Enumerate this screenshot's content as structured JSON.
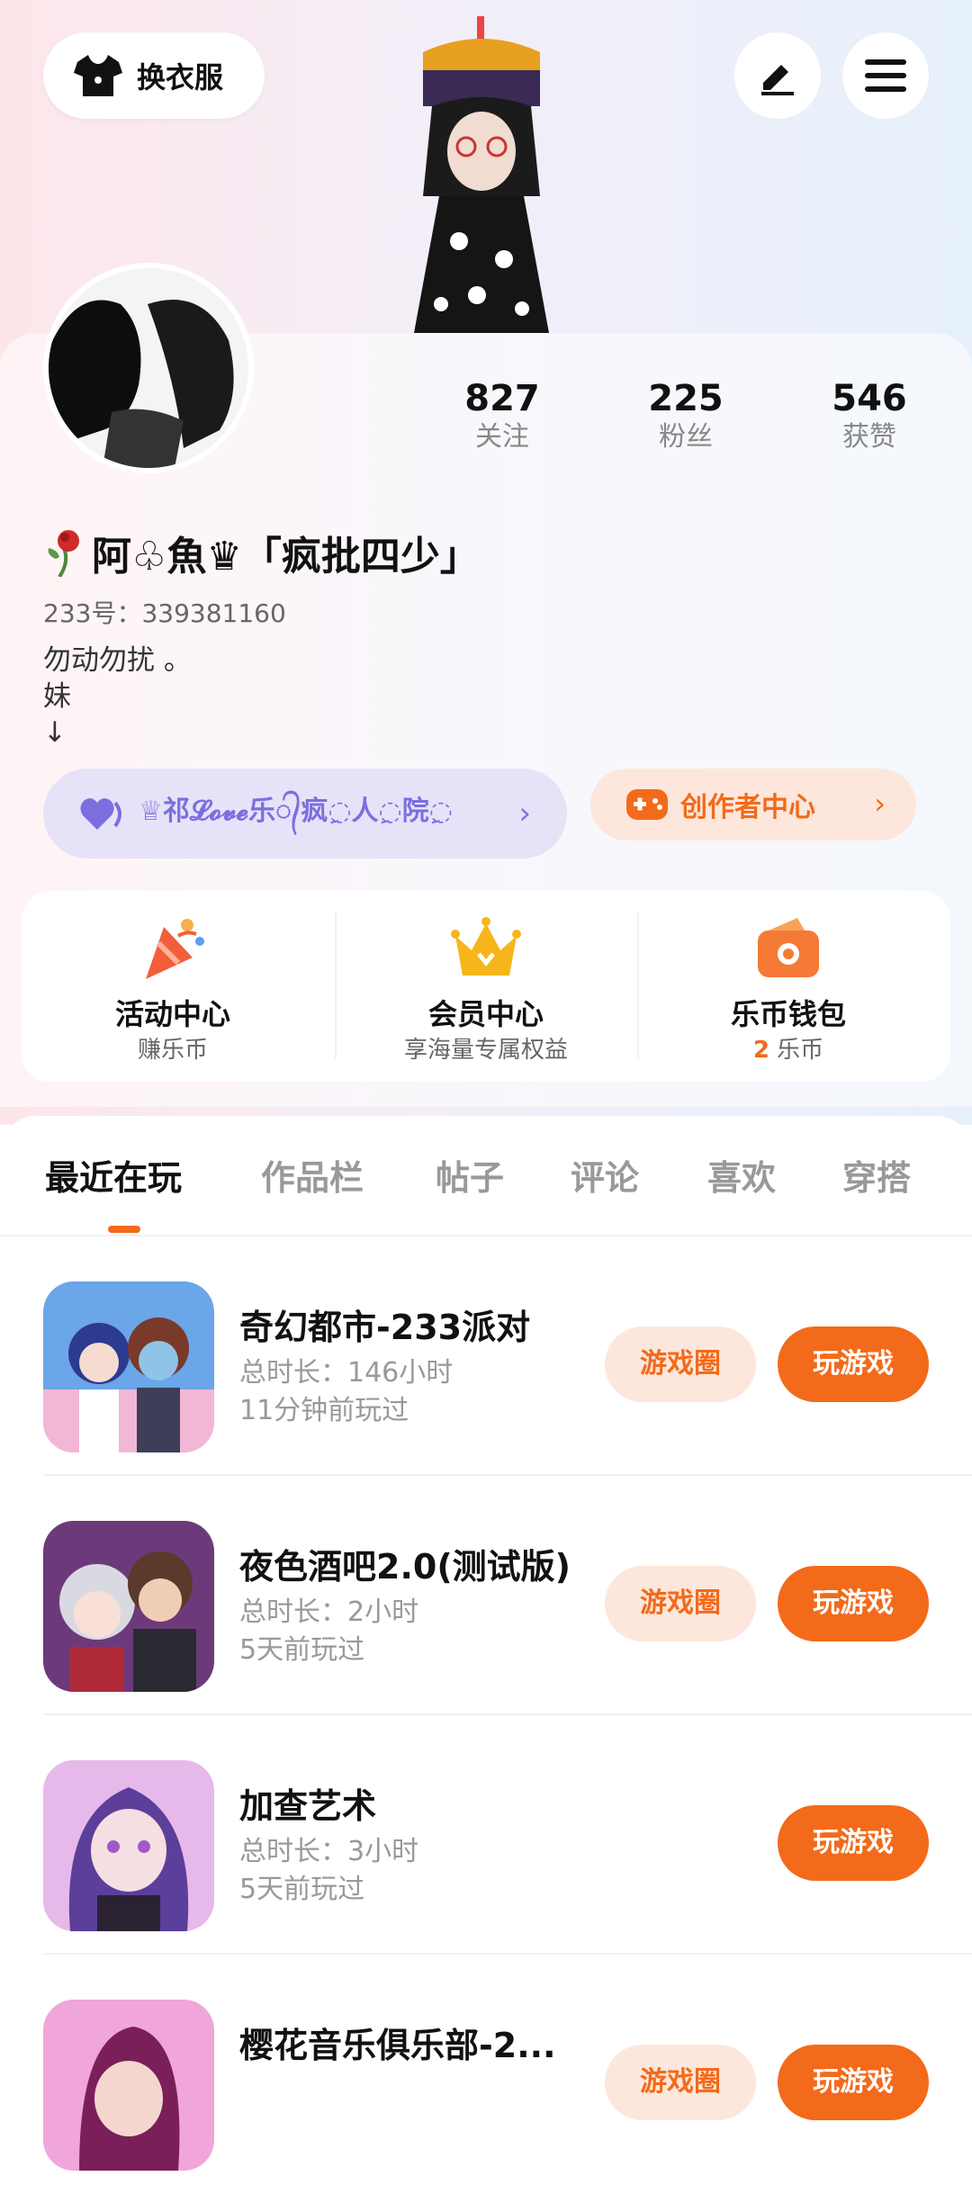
{
  "header": {
    "outfit_label": "换衣服",
    "edit_icon": "pencil-icon",
    "menu_icon": "hamburger-menu-icon"
  },
  "profile": {
    "stats": [
      {
        "value": "827",
        "label": "关注"
      },
      {
        "value": "225",
        "label": "粉丝"
      },
      {
        "value": "546",
        "label": "获赞"
      }
    ],
    "name": "阿♧魚♛「疯批四少」",
    "uid": "233号：339381160",
    "bio": "勿动勿扰 。\n妹\n↓",
    "club_label": "♕祁𝓛𝓸𝓿𝓮乐᭄疯◌ِ人◌ِ院◌ِ",
    "creator_label": "创作者中心"
  },
  "quick_entries": [
    {
      "title": "活动中心",
      "subtitle": "赚乐币",
      "icon": "party-popper-icon"
    },
    {
      "title": "会员中心",
      "subtitle": "享海量专属权益",
      "icon": "crown-icon"
    },
    {
      "title": "乐币钱包",
      "subtitle_count": "2",
      "subtitle_unit": "乐币",
      "icon": "wallet-icon"
    }
  ],
  "tabs": [
    "最近在玩",
    "作品栏",
    "帖子",
    "评论",
    "喜欢",
    "穿搭"
  ],
  "games": [
    {
      "title": "奇幻都市-233派对",
      "duration": "总时长：146小时",
      "last_played": "11分钟前玩过",
      "circle_label": "游戏圈",
      "play_label": "玩游戏"
    },
    {
      "title": "夜色酒吧2.0(测试版)",
      "duration": "总时长：2小时",
      "last_played": "5天前玩过",
      "circle_label": "游戏圈",
      "play_label": "玩游戏"
    },
    {
      "title": "加查艺术",
      "duration": "总时长：3小时",
      "last_played": "5天前玩过",
      "play_label": "玩游戏"
    },
    {
      "title": "樱花音乐俱乐部-2...",
      "circle_label": "游戏圈",
      "play_label": "玩游戏"
    }
  ],
  "colors": {
    "accent": "#f36a1a",
    "club": "#7b6fe0"
  }
}
